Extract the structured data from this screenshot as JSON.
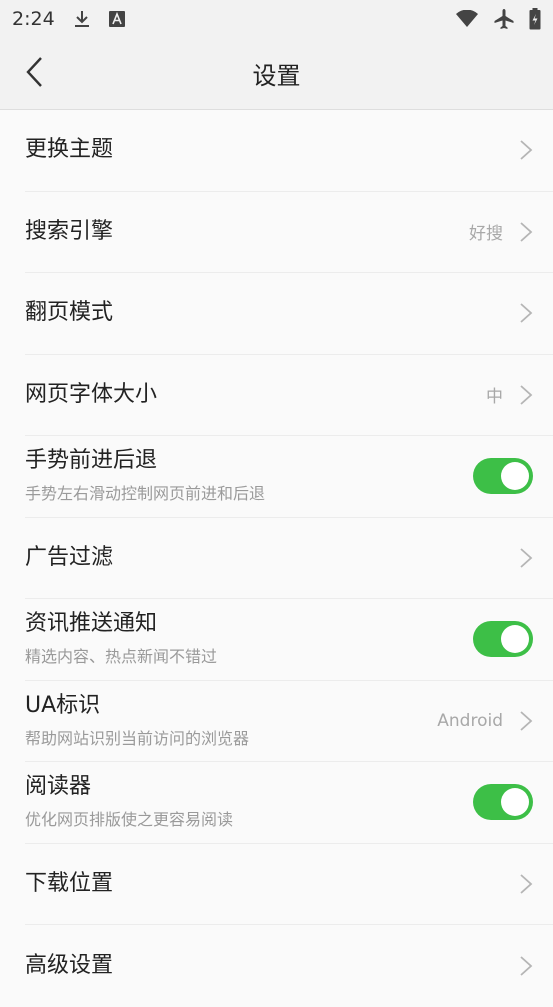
{
  "status_bar": {
    "time": "2:24",
    "icons": [
      "download-icon",
      "font-icon",
      "wifi-icon",
      "airplane-icon",
      "battery-icon"
    ]
  },
  "header": {
    "title": "设置",
    "back_icon": "chevron-left-icon"
  },
  "settings": [
    {
      "title": "更换主题",
      "type": "nav"
    },
    {
      "title": "搜索引擎",
      "type": "nav",
      "value": "好搜"
    },
    {
      "title": "翻页模式",
      "type": "nav"
    },
    {
      "title": "网页字体大小",
      "type": "nav",
      "value": "中"
    },
    {
      "title": "手势前进后退",
      "subtitle": "手势左右滑动控制网页前进和后退",
      "type": "toggle",
      "on": true
    },
    {
      "title": "广告过滤",
      "type": "nav"
    },
    {
      "title": "资讯推送通知",
      "subtitle": "精选内容、热点新闻不错过",
      "type": "toggle",
      "on": true
    },
    {
      "title": "UA标识",
      "subtitle": "帮助网站识别当前访问的浏览器",
      "type": "nav",
      "value": "Android"
    },
    {
      "title": "阅读器",
      "subtitle": "优化网页排版使之更容易阅读",
      "type": "toggle",
      "on": true
    },
    {
      "title": "下载位置",
      "type": "nav"
    },
    {
      "title": "高级设置",
      "type": "nav"
    }
  ],
  "colors": {
    "toggle_on": "#3dbf47",
    "background": "#fafafa",
    "header_bg": "#f2f2f2"
  }
}
